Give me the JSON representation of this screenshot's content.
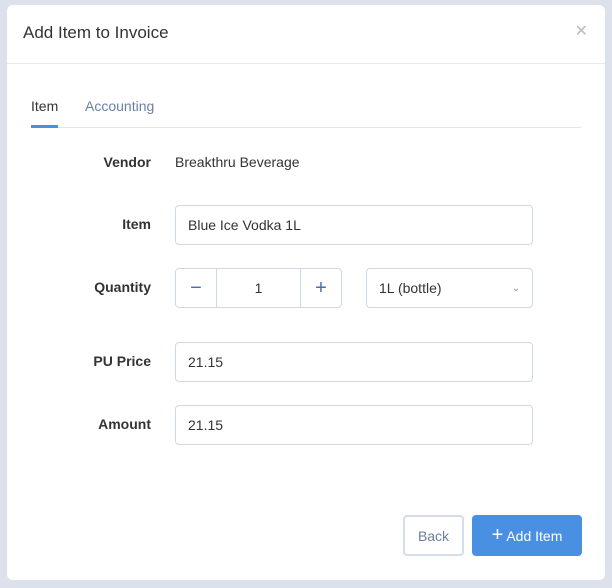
{
  "modal": {
    "title": "Add Item to Invoice",
    "close_icon": "close-icon"
  },
  "tabs": [
    {
      "label": "Item",
      "active": true
    },
    {
      "label": "Accounting",
      "active": false
    }
  ],
  "form": {
    "vendor_label": "Vendor",
    "vendor_value": "Breakthru Beverage",
    "item_label": "Item",
    "item_value": "Blue Ice Vodka 1L",
    "quantity_label": "Quantity",
    "quantity_value": "1",
    "unit_value": "1L (bottle)",
    "pu_price_label": "PU Price",
    "pu_price_value": "21.15",
    "amount_label": "Amount",
    "amount_value": "21.15"
  },
  "footer": {
    "back_label": "Back",
    "add_label": "Add Item"
  },
  "colors": {
    "accent": "#4a90e2",
    "backdrop": "#dde1ec"
  }
}
